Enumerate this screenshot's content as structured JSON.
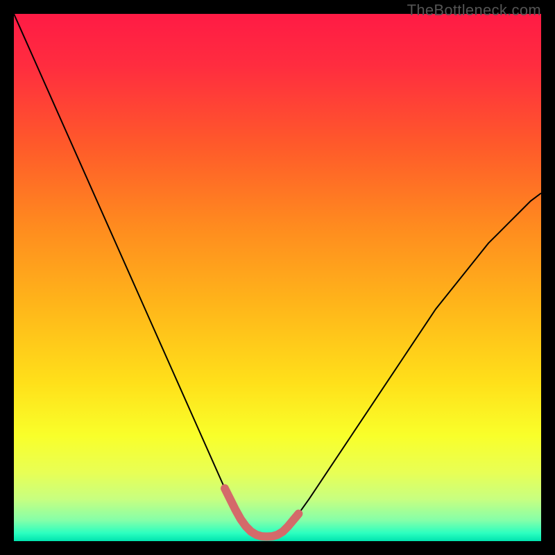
{
  "watermark": "TheBottleneck.com",
  "chart_data": {
    "type": "line",
    "title": "",
    "xlabel": "",
    "ylabel": "",
    "xlim": [
      0,
      100
    ],
    "ylim": [
      0,
      100
    ],
    "gradient_stops": [
      {
        "offset": 0.0,
        "color": "#ff1b45"
      },
      {
        "offset": 0.1,
        "color": "#ff2d3f"
      },
      {
        "offset": 0.25,
        "color": "#ff5a2a"
      },
      {
        "offset": 0.4,
        "color": "#ff8a1f"
      },
      {
        "offset": 0.55,
        "color": "#ffb51a"
      },
      {
        "offset": 0.7,
        "color": "#ffe01a"
      },
      {
        "offset": 0.8,
        "color": "#f9ff2a"
      },
      {
        "offset": 0.87,
        "color": "#e8ff55"
      },
      {
        "offset": 0.92,
        "color": "#c8ff80"
      },
      {
        "offset": 0.96,
        "color": "#86ffa8"
      },
      {
        "offset": 0.985,
        "color": "#2bffc0"
      },
      {
        "offset": 1.0,
        "color": "#00e3af"
      }
    ],
    "series": [
      {
        "name": "bottleneck-curve",
        "color": "#000000",
        "stroke_width": 2,
        "x": [
          0,
          2,
          4,
          6,
          8,
          10,
          12,
          14,
          16,
          18,
          20,
          22,
          24,
          26,
          28,
          30,
          32,
          34,
          36,
          38,
          40,
          42,
          43,
          44,
          45,
          46,
          47,
          48,
          49,
          50,
          51,
          52,
          54,
          56,
          58,
          60,
          62,
          64,
          66,
          68,
          70,
          72,
          74,
          76,
          78,
          80,
          82,
          84,
          86,
          88,
          90,
          92,
          94,
          96,
          98,
          100
        ],
        "y": [
          100,
          95.5,
          91,
          86.5,
          82,
          77.5,
          73,
          68.5,
          64,
          59.5,
          55,
          50.5,
          46,
          41.5,
          37,
          32.5,
          28,
          23.5,
          19,
          14.5,
          10,
          6,
          4.2,
          2.8,
          1.8,
          1.2,
          0.9,
          0.85,
          0.9,
          1.2,
          1.8,
          2.8,
          5.2,
          8,
          11,
          14,
          17,
          20,
          23,
          26,
          29,
          32,
          35,
          38,
          41,
          44,
          46.5,
          49,
          51.5,
          54,
          56.5,
          58.5,
          60.5,
          62.5,
          64.5,
          66
        ]
      }
    ],
    "highlight": {
      "color": "#d46a6a",
      "stroke_width": 12,
      "x": [
        40,
        41,
        42,
        43,
        44,
        45,
        46,
        47,
        48,
        49,
        50,
        51,
        52,
        53,
        54
      ],
      "y": [
        10,
        8,
        6,
        4.2,
        2.8,
        1.8,
        1.2,
        0.9,
        0.85,
        0.9,
        1.2,
        1.8,
        2.8,
        4,
        5.2
      ]
    }
  }
}
